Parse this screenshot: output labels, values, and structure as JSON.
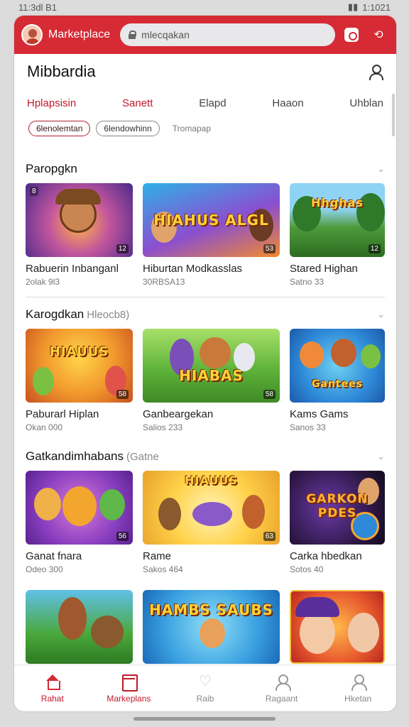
{
  "status_bar": {
    "time": "11:3dl B1",
    "right": "1:1021"
  },
  "topbar": {
    "brand": "Marketplace",
    "search_value": "mlecqakan",
    "accent": "#d62a35"
  },
  "header": {
    "title": "Mibbardia"
  },
  "tabs": [
    {
      "label": "Hplapsisin",
      "active": true
    },
    {
      "label": "Sanett",
      "active": false
    },
    {
      "label": "Elapd",
      "active": false
    },
    {
      "label": "Haaon",
      "active": false
    },
    {
      "label": "Uhblan",
      "active": false
    }
  ],
  "chips": [
    {
      "label": "6lenolemtan",
      "style": "red"
    },
    {
      "label": "6lendowhinn",
      "style": "outline"
    },
    {
      "label": "Tromapap",
      "style": "plain"
    }
  ],
  "sections": [
    {
      "title": "Paropgkn",
      "subtitle": "",
      "cards": [
        {
          "title": "Rabuerin Inbanganl",
          "meta": "2olak 9l3",
          "art_text": "",
          "tag": "12",
          "badge": "8"
        },
        {
          "title": "Hiburtan Modkasslas",
          "meta": "30RBSA13",
          "art_text": "HIAHUS ALGL",
          "tag": "53",
          "badge": ""
        },
        {
          "title": "Stared Highan",
          "meta": "Satno 33",
          "art_text": "Hhghas",
          "tag": "12",
          "badge": ""
        }
      ]
    },
    {
      "title": "Karogdkan",
      "subtitle": "Hleocb8)",
      "cards": [
        {
          "title": "Paburarl Hiplan",
          "meta": "Okan 000",
          "art_text": "HIAUUS",
          "tag": "58",
          "badge": ""
        },
        {
          "title": "Ganbeargekan",
          "meta": "Salios 233",
          "art_text": "HIABAS",
          "tag": "58",
          "badge": ""
        },
        {
          "title": "Kams Gams",
          "meta": "Sanos 33",
          "art_text": "Gantees",
          "tag": "",
          "badge": ""
        }
      ]
    },
    {
      "title": "Gatkandimhabans",
      "subtitle": "(Gatne",
      "cards": [
        {
          "title": "Ganat fnara",
          "meta": "Odeo 300",
          "art_text": "",
          "tag": "56",
          "badge": ""
        },
        {
          "title": "Rame",
          "meta": "Sakos 464",
          "art_text": "HIAUUS",
          "tag": "63",
          "badge": ""
        },
        {
          "title": "Carka hbedkan",
          "meta": "Sotos 40",
          "art_text": "GARKON PDES",
          "tag": "",
          "badge": ""
        }
      ]
    },
    {
      "title": "",
      "subtitle": "",
      "cards": [
        {
          "title": "",
          "meta": "",
          "art_text": "",
          "tag": "",
          "badge": ""
        },
        {
          "title": "",
          "meta": "",
          "art_text": "HAMBS SAUBS",
          "tag": "",
          "badge": ""
        },
        {
          "title": "",
          "meta": "",
          "art_text": "",
          "tag": "",
          "badge": ""
        }
      ]
    }
  ],
  "bottom_nav": [
    {
      "label": "Rahat",
      "icon": "home-icon",
      "active": true
    },
    {
      "label": "Markeplans",
      "icon": "marketplace-icon",
      "active": true
    },
    {
      "label": "Raib",
      "icon": "heart-icon",
      "active": false
    },
    {
      "label": "Ragaant",
      "icon": "person-icon",
      "active": false
    },
    {
      "label": "Hketan",
      "icon": "profile-icon",
      "active": false
    }
  ]
}
